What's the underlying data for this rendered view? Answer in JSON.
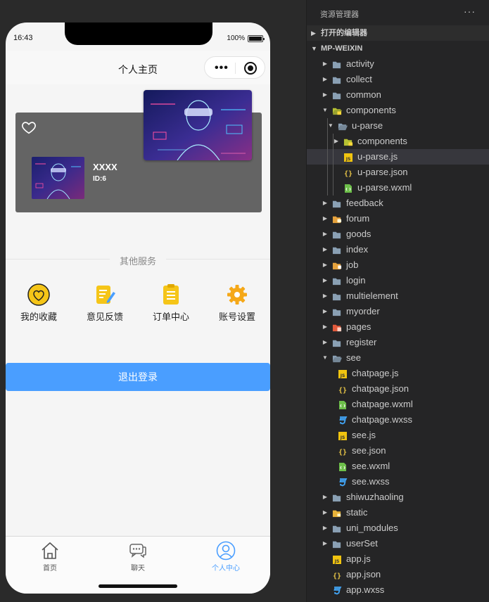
{
  "phone": {
    "status": {
      "time": "16:43",
      "battery": "100%",
      "battery_level": 1.0
    },
    "navbar": {
      "title": "个人主页"
    },
    "profile": {
      "name": "XXXX",
      "id_text": "ID:6"
    },
    "section_title": "其他服务",
    "services": [
      {
        "label": "我的收藏",
        "icon": "heart-icon"
      },
      {
        "label": "意见反馈",
        "icon": "feedback-icon"
      },
      {
        "label": "订单中心",
        "icon": "order-icon"
      },
      {
        "label": "账号设置",
        "icon": "settings-icon"
      }
    ],
    "logout_label": "退出登录",
    "tabs": [
      {
        "label": "首页",
        "icon": "home-icon",
        "active": false
      },
      {
        "label": "聊天",
        "icon": "chat-icon",
        "active": false
      },
      {
        "label": "个人中心",
        "icon": "user-icon",
        "active": true
      }
    ]
  },
  "explorer": {
    "title": "资源管理器",
    "more": "···",
    "open_editors": "打开的编辑器",
    "project": "MP-WEIXIN",
    "tree": [
      {
        "name": "activity",
        "depth": 0,
        "kind": "folder",
        "expanded": false
      },
      {
        "name": "collect",
        "depth": 0,
        "kind": "folder",
        "expanded": false
      },
      {
        "name": "common",
        "depth": 0,
        "kind": "folder",
        "expanded": false
      },
      {
        "name": "components",
        "depth": 0,
        "kind": "folder-components",
        "expanded": true
      },
      {
        "name": "u-parse",
        "depth": 1,
        "kind": "folder",
        "expanded": true
      },
      {
        "name": "components",
        "depth": 2,
        "kind": "folder-components",
        "expanded": false
      },
      {
        "name": "u-parse.js",
        "depth": 2,
        "kind": "js",
        "selected": true
      },
      {
        "name": "u-parse.json",
        "depth": 2,
        "kind": "json"
      },
      {
        "name": "u-parse.wxml",
        "depth": 2,
        "kind": "wxml"
      },
      {
        "name": "feedback",
        "depth": 0,
        "kind": "folder",
        "expanded": false
      },
      {
        "name": "forum",
        "depth": 0,
        "kind": "folder-forum",
        "expanded": false
      },
      {
        "name": "goods",
        "depth": 0,
        "kind": "folder",
        "expanded": false
      },
      {
        "name": "index",
        "depth": 0,
        "kind": "folder",
        "expanded": false
      },
      {
        "name": "job",
        "depth": 0,
        "kind": "folder-job",
        "expanded": false
      },
      {
        "name": "login",
        "depth": 0,
        "kind": "folder",
        "expanded": false
      },
      {
        "name": "multielement",
        "depth": 0,
        "kind": "folder",
        "expanded": false
      },
      {
        "name": "myorder",
        "depth": 0,
        "kind": "folder",
        "expanded": false
      },
      {
        "name": "pages",
        "depth": 0,
        "kind": "folder-pages",
        "expanded": false
      },
      {
        "name": "register",
        "depth": 0,
        "kind": "folder",
        "expanded": false
      },
      {
        "name": "see",
        "depth": 0,
        "kind": "folder",
        "expanded": true
      },
      {
        "name": "chatpage.js",
        "depth": 1,
        "kind": "js"
      },
      {
        "name": "chatpage.json",
        "depth": 1,
        "kind": "json"
      },
      {
        "name": "chatpage.wxml",
        "depth": 1,
        "kind": "wxml"
      },
      {
        "name": "chatpage.wxss",
        "depth": 1,
        "kind": "wxss"
      },
      {
        "name": "see.js",
        "depth": 1,
        "kind": "js"
      },
      {
        "name": "see.json",
        "depth": 1,
        "kind": "json"
      },
      {
        "name": "see.wxml",
        "depth": 1,
        "kind": "wxml"
      },
      {
        "name": "see.wxss",
        "depth": 1,
        "kind": "wxss"
      },
      {
        "name": "shiwuzhaoling",
        "depth": 0,
        "kind": "folder",
        "expanded": false
      },
      {
        "name": "static",
        "depth": 0,
        "kind": "folder-static",
        "expanded": false
      },
      {
        "name": "uni_modules",
        "depth": 0,
        "kind": "folder",
        "expanded": false
      },
      {
        "name": "userSet",
        "depth": 0,
        "kind": "folder",
        "expanded": false
      },
      {
        "name": "app.js",
        "depth": 0,
        "kind": "js"
      },
      {
        "name": "app.json",
        "depth": 0,
        "kind": "json"
      },
      {
        "name": "app.wxss",
        "depth": 0,
        "kind": "wxss"
      }
    ]
  },
  "colors": {
    "accent": "#4a9eff",
    "card": "#646464",
    "service_yellow": "#f5c518",
    "explorer_bg": "#252526",
    "selected_row": "#37373d"
  }
}
